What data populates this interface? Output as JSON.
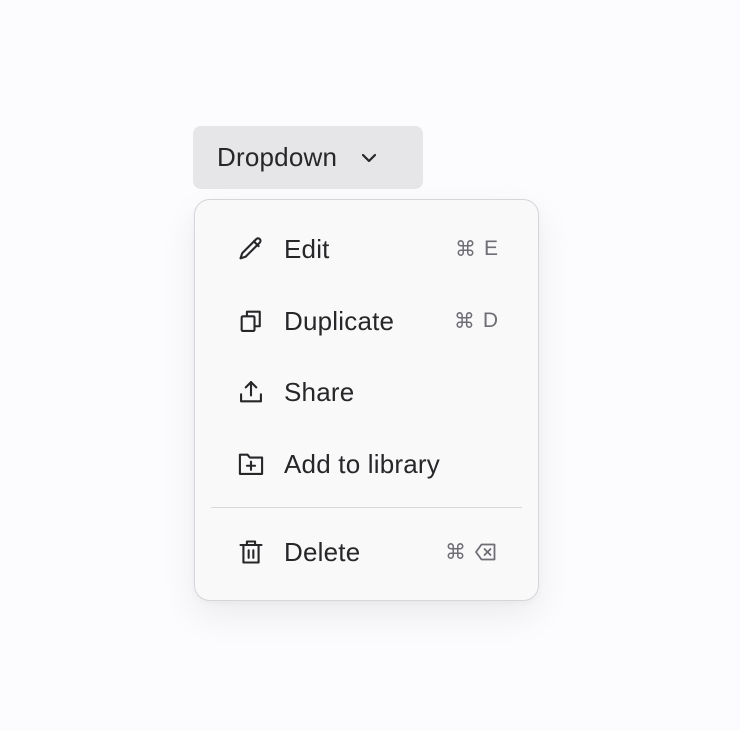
{
  "trigger": {
    "label": "Dropdown",
    "icon": "chevron-down-icon"
  },
  "menu": {
    "items": [
      {
        "label": "Edit",
        "icon": "pencil-icon",
        "shortcut_mod": "⌘",
        "shortcut_key": "E"
      },
      {
        "label": "Duplicate",
        "icon": "duplicate-icon",
        "shortcut_mod": "⌘",
        "shortcut_key": "D"
      },
      {
        "label": "Share",
        "icon": "share-icon",
        "shortcut_mod": "",
        "shortcut_key": ""
      },
      {
        "label": "Add to library",
        "icon": "folder-plus-icon",
        "shortcut_mod": "",
        "shortcut_key": ""
      }
    ],
    "danger_item": {
      "label": "Delete",
      "icon": "trash-icon",
      "shortcut_mod": "⌘",
      "shortcut_key_icon": "backspace-icon"
    }
  },
  "colors": {
    "page_background": "#fcfbfd",
    "trigger_background": "#e6e5e8",
    "menu_background": "#f9f9fa",
    "menu_border": "#d6d5d9",
    "text": "#27272a",
    "shortcut_text": "#6e6e75"
  }
}
